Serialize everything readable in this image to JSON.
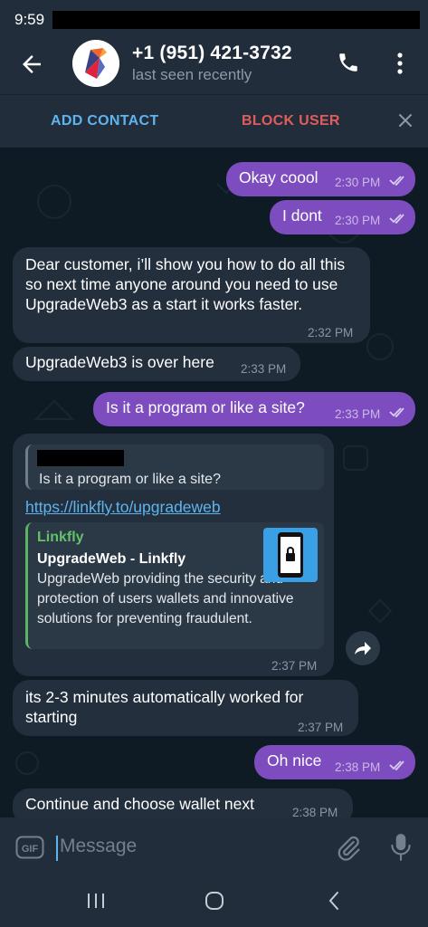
{
  "status_bar": {
    "time": "9:59"
  },
  "header": {
    "title": "+1 (951) 421-3732",
    "subtitle": "last seen recently",
    "back_icon": "arrow-left-icon",
    "call_icon": "phone-icon",
    "menu_icon": "more-vertical-icon"
  },
  "action_bar": {
    "add_contact": "ADD CONTACT",
    "block_user": "BLOCK USER",
    "close_icon": "close-icon"
  },
  "messages": [
    {
      "dir": "out",
      "text": "Okay coool",
      "time": "2:30 PM",
      "read": true
    },
    {
      "dir": "out",
      "text": "I dont",
      "time": "2:30 PM",
      "read": true
    },
    {
      "dir": "in",
      "text": "Dear customer, i’ll show you how to do all this so next time anyone around you need to use UpgradeWeb3  as a start it works faster.",
      "time": "2:32 PM"
    },
    {
      "dir": "in",
      "text": "UpgradeWeb3 is over here",
      "time": "2:33 PM"
    },
    {
      "dir": "out",
      "text": "Is it a program or like a site?",
      "time": "2:33 PM",
      "read": true
    },
    {
      "dir": "in",
      "reply_text": "Is it a program or like a site?",
      "link": "https://linkfly.to/upgradeweb",
      "preview": {
        "site": "Linkfly",
        "title": "UpgradeWeb - Linkfly",
        "description": "UpgradeWeb providing the security and protection of users wallets and innovative solutions for preventing fraudulent."
      },
      "time": "2:37 PM"
    },
    {
      "dir": "in",
      "text": "its 2-3 minutes automatically worked for starting",
      "time": "2:37 PM"
    },
    {
      "dir": "out",
      "text": "Oh nice",
      "time": "2:38 PM",
      "read": true
    },
    {
      "dir": "in",
      "text": "Continue and choose wallet next",
      "time": "2:38 PM"
    }
  ],
  "input": {
    "placeholder": "Message"
  },
  "colors": {
    "outgoing_bubble": "#7d4dc0",
    "incoming_bubble": "#232f3c",
    "accent": "#5fb4ee",
    "danger": "#e25c5c"
  }
}
